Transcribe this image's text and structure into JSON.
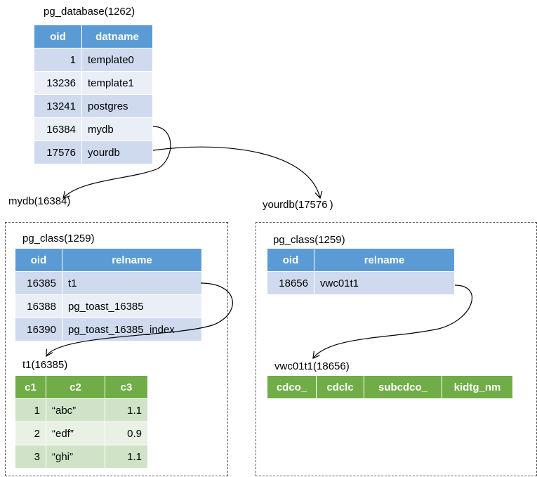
{
  "pg_database": {
    "title": "pg_database(1262)",
    "headers": [
      "oid",
      "datname"
    ],
    "rows": [
      [
        "1",
        "template0"
      ],
      [
        "13236",
        "template1"
      ],
      [
        "13241",
        "postgres"
      ],
      [
        "16384",
        "mydb"
      ],
      [
        "17576",
        "yourdb"
      ]
    ]
  },
  "mydb": {
    "label": "mydb(16384)",
    "pg_class": {
      "title": "pg_class(1259)",
      "headers": [
        "oid",
        "relname"
      ],
      "rows": [
        [
          "16385",
          "t1"
        ],
        [
          "16388",
          "pg_toast_16385"
        ],
        [
          "16390",
          "pg_toast_16385_index"
        ]
      ]
    },
    "t1": {
      "title": "t1(16385)",
      "headers": [
        "c1",
        "c2",
        "c3"
      ],
      "rows": [
        [
          "1",
          "“abc”",
          "1.1"
        ],
        [
          "2",
          "“edf”",
          "0.9"
        ],
        [
          "3",
          "“ghi”",
          "1.1"
        ]
      ]
    }
  },
  "yourdb": {
    "label": "yourdb(17576 )",
    "pg_class": {
      "title": "pg_class(1259)",
      "headers": [
        "oid",
        "relname"
      ],
      "rows": [
        [
          "18656",
          "vwc01t1"
        ]
      ]
    },
    "vwc01t1": {
      "title": "vwc01t1(18656)",
      "headers": [
        "cdco_",
        "cdclc",
        "subcdco_",
        "kidtg_nm"
      ]
    }
  },
  "colors": {
    "blue_header": "#5b9bd5",
    "green_header": "#70ad47",
    "blue_row_dark": "#cfdaee",
    "blue_row_light": "#e9eef7",
    "green_row_dark": "#d0e3c7",
    "green_row_light": "#e9f1e4"
  }
}
